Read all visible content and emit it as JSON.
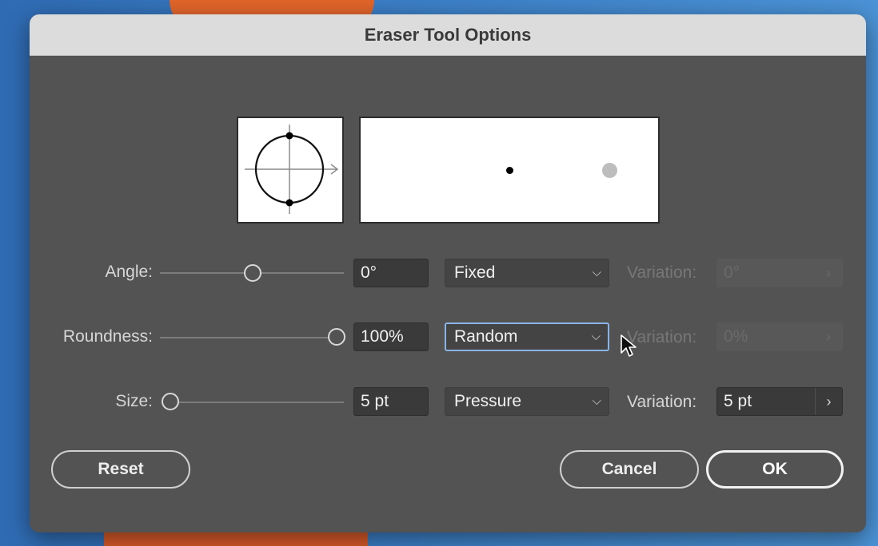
{
  "dialog": {
    "title": "Eraser Tool Options"
  },
  "rows": {
    "angle": {
      "label": "Angle:",
      "value": "0°",
      "mode": "Fixed",
      "variation_label": "Variation:",
      "variation_value": "0°",
      "slider_fraction": 0.5
    },
    "roundness": {
      "label": "Roundness:",
      "value": "100%",
      "mode": "Random",
      "variation_label": "Variation:",
      "variation_value": "0%",
      "slider_fraction": 1.0
    },
    "size": {
      "label": "Size:",
      "value": "5 pt",
      "mode": "Pressure",
      "variation_label": "Variation:",
      "variation_value": "5 pt",
      "slider_fraction": 0.0
    }
  },
  "buttons": {
    "reset": "Reset",
    "cancel": "Cancel",
    "ok": "OK"
  },
  "icons": {
    "select_chevron": "chevron-down-icon",
    "variation_arrow": "chevron-right-icon"
  }
}
